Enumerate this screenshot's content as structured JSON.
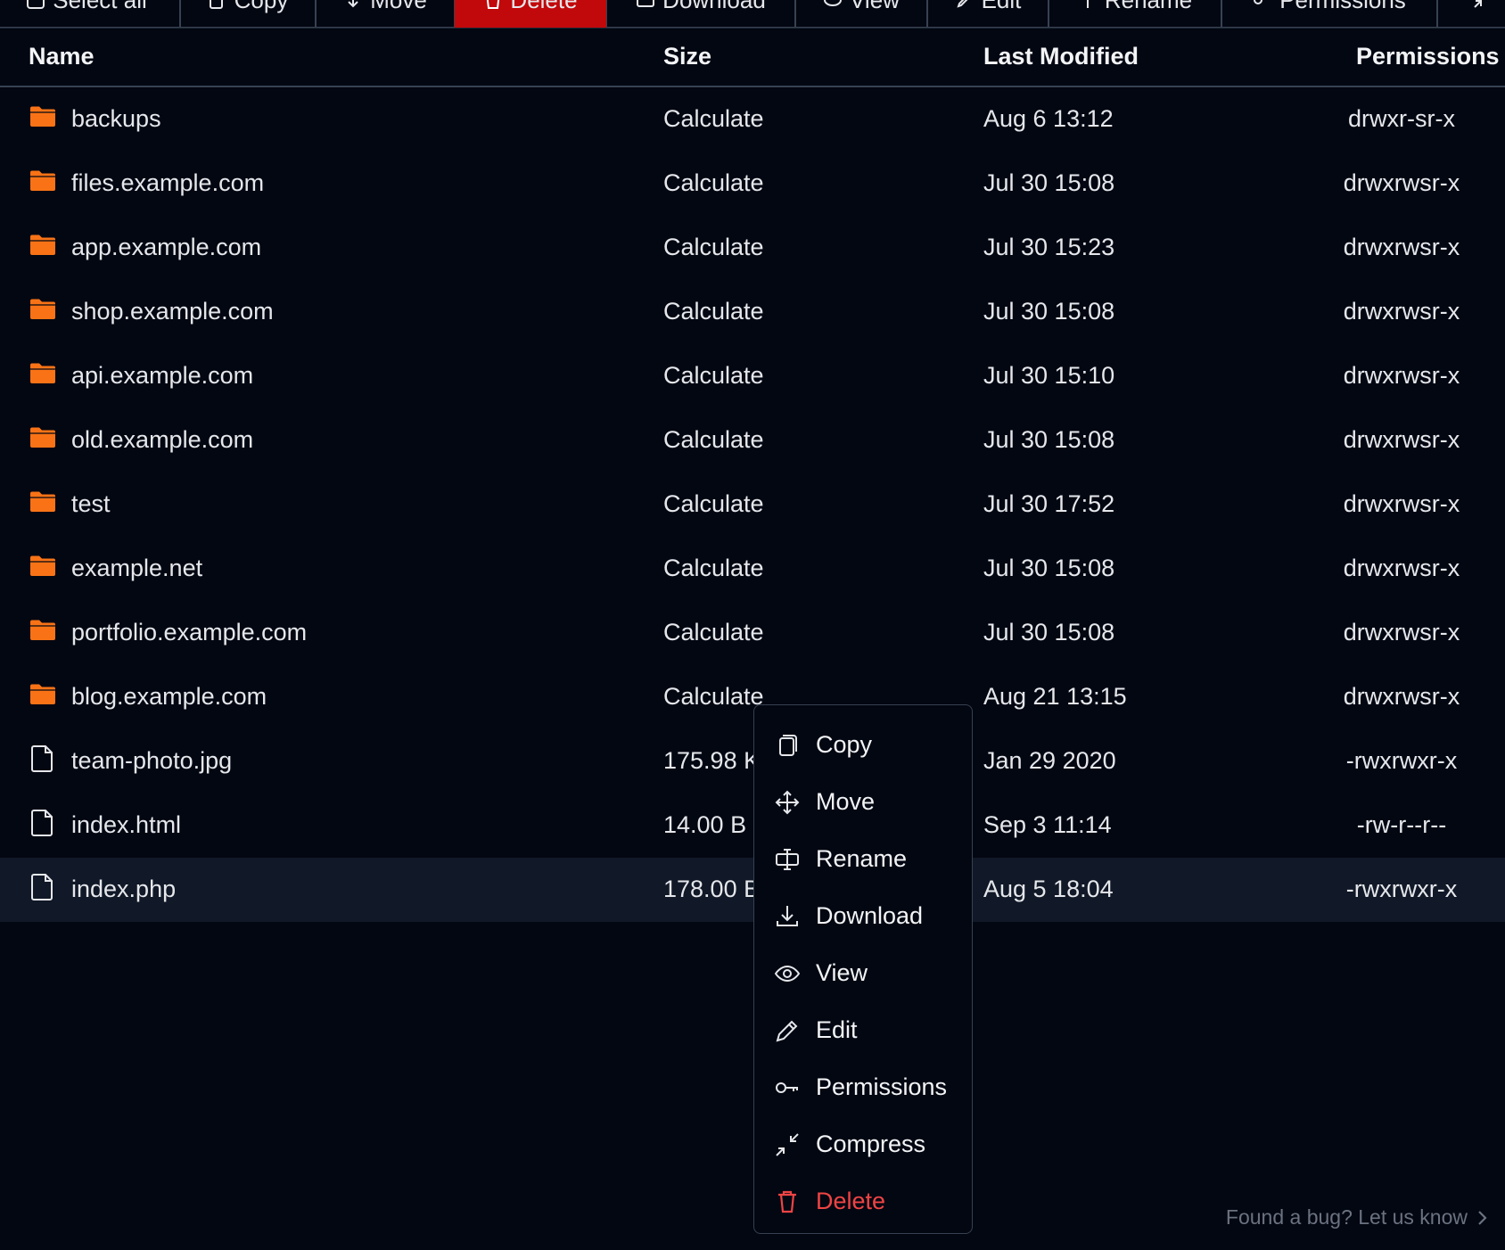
{
  "toolbar": {
    "buttons": [
      {
        "label": "Select all",
        "icon": "select-all-icon"
      },
      {
        "label": "Copy",
        "icon": "copy-icon"
      },
      {
        "label": "Move",
        "icon": "move-icon"
      },
      {
        "label": "Delete",
        "icon": "trash-icon"
      },
      {
        "label": "Download",
        "icon": "download-icon"
      },
      {
        "label": "View",
        "icon": "eye-icon"
      },
      {
        "label": "Edit",
        "icon": "pencil-icon"
      },
      {
        "label": "Rename",
        "icon": "rename-icon"
      },
      {
        "label": "Permissions",
        "icon": "key-icon"
      }
    ]
  },
  "table": {
    "headers": {
      "name": "Name",
      "size": "Size",
      "modified": "Last Modified",
      "permissions": "Permissions"
    },
    "rows": [
      {
        "type": "folder",
        "name": "backups",
        "size": "Calculate",
        "modified": "Aug 6 13:12",
        "permissions": "drwxr-sr-x"
      },
      {
        "type": "folder",
        "name": "files.example.com",
        "size": "Calculate",
        "modified": "Jul 30 15:08",
        "permissions": "drwxrwsr-x"
      },
      {
        "type": "folder",
        "name": "app.example.com",
        "size": "Calculate",
        "modified": "Jul 30 15:23",
        "permissions": "drwxrwsr-x"
      },
      {
        "type": "folder",
        "name": "shop.example.com",
        "size": "Calculate",
        "modified": "Jul 30 15:08",
        "permissions": "drwxrwsr-x"
      },
      {
        "type": "folder",
        "name": "api.example.com",
        "size": "Calculate",
        "modified": "Jul 30 15:10",
        "permissions": "drwxrwsr-x"
      },
      {
        "type": "folder",
        "name": "old.example.com",
        "size": "Calculate",
        "modified": "Jul 30 15:08",
        "permissions": "drwxrwsr-x"
      },
      {
        "type": "folder",
        "name": "test",
        "size": "Calculate",
        "modified": "Jul 30 17:52",
        "permissions": "drwxrwsr-x"
      },
      {
        "type": "folder",
        "name": "example.net",
        "size": "Calculate",
        "modified": "Jul 30 15:08",
        "permissions": "drwxrwsr-x"
      },
      {
        "type": "folder",
        "name": "portfolio.example.com",
        "size": "Calculate",
        "modified": "Jul 30 15:08",
        "permissions": "drwxrwsr-x"
      },
      {
        "type": "folder",
        "name": "blog.example.com",
        "size": "Calculate",
        "modified": "Aug 21 13:15",
        "permissions": "drwxrwsr-x"
      },
      {
        "type": "file",
        "name": "team-photo.jpg",
        "size": "175.98 KB",
        "modified": "Jan 29 2020",
        "permissions": "-rwxrwxr-x"
      },
      {
        "type": "file",
        "name": "index.html",
        "size": "14.00 B",
        "modified": "Sep 3 11:14",
        "permissions": "-rw-r--r--"
      },
      {
        "type": "file",
        "name": "index.php",
        "size": "178.00 B",
        "modified": "Aug 5 18:04",
        "permissions": "-rwxrwxr-x",
        "selected": true
      }
    ]
  },
  "context_menu": {
    "items": [
      {
        "label": "Copy",
        "icon": "copy-icon"
      },
      {
        "label": "Move",
        "icon": "move-icon"
      },
      {
        "label": "Rename",
        "icon": "rename-icon"
      },
      {
        "label": "Download",
        "icon": "download-icon"
      },
      {
        "label": "View",
        "icon": "eye-icon"
      },
      {
        "label": "Edit",
        "icon": "pencil-icon"
      },
      {
        "label": "Permissions",
        "icon": "key-icon"
      },
      {
        "label": "Compress",
        "icon": "compress-icon"
      },
      {
        "label": "Delete",
        "icon": "trash-icon",
        "danger": true
      }
    ]
  },
  "footer": {
    "bug_link": "Found a bug? Let us know"
  },
  "colors": {
    "folder": "#f97316",
    "danger": "#c1080a",
    "danger_text": "#ef4444",
    "background": "#030712"
  }
}
